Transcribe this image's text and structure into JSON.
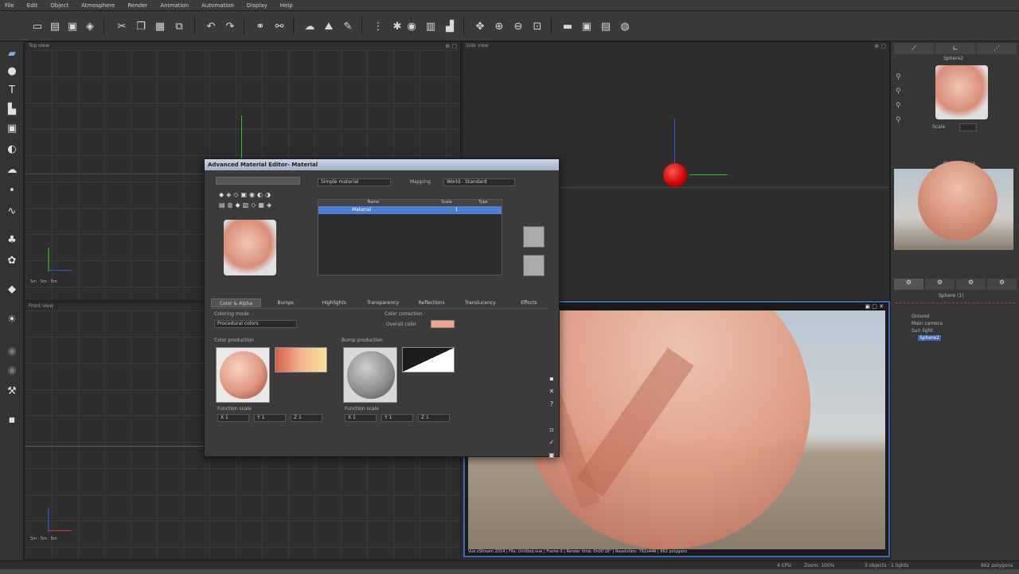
{
  "app": {
    "menu": [
      "File",
      "Edit",
      "Object",
      "Atmosphere",
      "Render",
      "Animation",
      "Automation",
      "Display",
      "Help"
    ]
  },
  "viewports": {
    "top": {
      "label": "Top view"
    },
    "side": {
      "label": "Side view"
    },
    "front": {
      "label": "Front view"
    }
  },
  "material_editor": {
    "title": "Advanced Material Editor- Material",
    "material_type": "Simple material",
    "mapping_label": "Mapping",
    "mapping_value": "World - Standard",
    "layer_headers": [
      "Name",
      "Scale",
      "Type"
    ],
    "layer_row": {
      "name": "Material",
      "scale": "1"
    },
    "tabs": [
      "Color & Alpha",
      "Bumps",
      "Highlights",
      "Transparency",
      "Reflections",
      "Translucency",
      "Effects"
    ],
    "coloring_mode_label": "Coloring mode",
    "coloring_mode_value": "Procedural colors",
    "color_correction_label": "Color correction",
    "overall_color_label": "Overall color",
    "overall_color": "#f2a488",
    "color_production_label": "Color production",
    "bump_production_label": "Bump production",
    "function_scale_label": "Function scale",
    "scale_left": [
      "X 1",
      "Y 1",
      "Z 1"
    ],
    "scale_right": [
      "X 1",
      "Y 1",
      "Z 1"
    ]
  },
  "right_panel": {
    "object_name": "Sphere2",
    "scale_label": "Scale",
    "camera_label": "Main Camera",
    "scene_title": "Sphere (1)",
    "tree": [
      "Ground",
      "Main camera",
      "Sun light",
      "Sphere2"
    ]
  },
  "render": {
    "status": "Vue xStream 2014 | File: Untitled.vue | Frame 0 | Render time: 0h00'26\" | Resolution: 762x446 | 862 polygons"
  },
  "statusbar": {
    "cpu": "4 CPU",
    "zoom": "Zoom: 100%",
    "objects": "3 objects · 1 lights",
    "polygons": "862 polygons"
  }
}
